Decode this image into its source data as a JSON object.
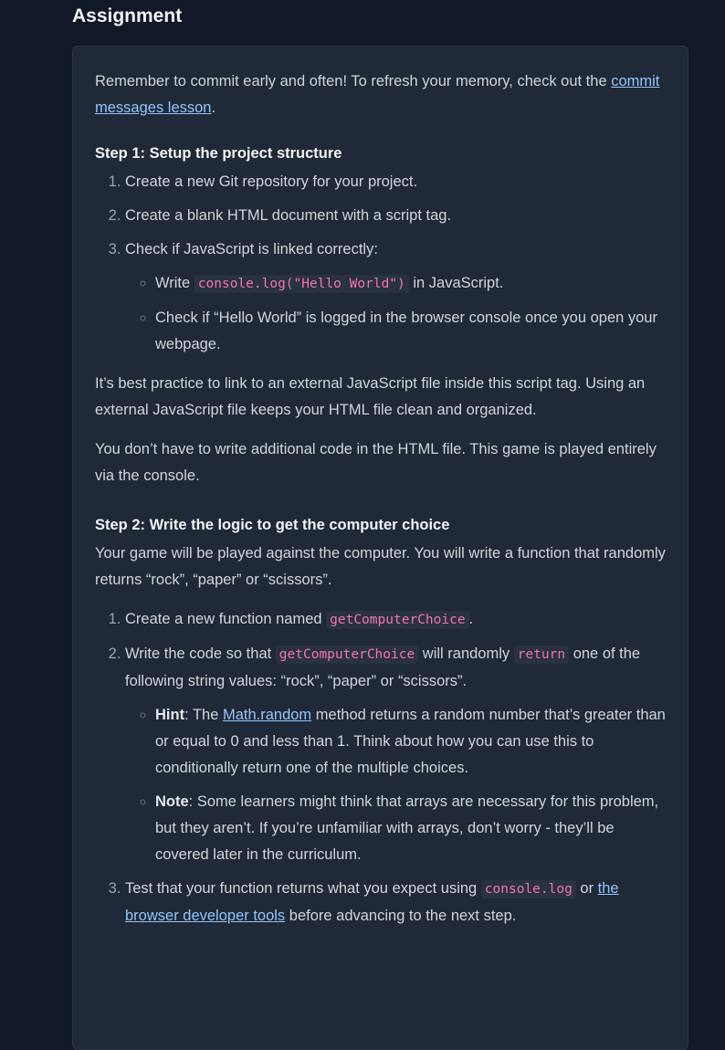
{
  "title": "Assignment",
  "intro": {
    "text": "Remember to commit early and often! To refresh your memory, check out the ",
    "link": "commit messages lesson",
    "end": "."
  },
  "step1": {
    "heading": "Step 1: Setup the project structure",
    "items": [
      "Create a new Git repository for your project.",
      "Create a blank HTML document with a script tag.",
      "Check if JavaScript is linked correctly:"
    ],
    "sub": {
      "a_pre": "Write ",
      "a_code": "console.log(\"Hello World\")",
      "a_post": " in JavaScript.",
      "b": "Check if “Hello World” is logged in the browser console once you open your webpage."
    },
    "p1": "It’s best practice to link to an external JavaScript file inside this script tag. Using an external JavaScript file keeps your HTML file clean and organized.",
    "p2": "You don’t have to write additional code in the HTML file. This game is played entirely via the console."
  },
  "step2": {
    "heading": "Step 2: Write the logic to get the computer choice",
    "intro": "Your game will be played against the computer. You will write a function that randomly returns “rock”, “paper” or “scissors”.",
    "item1": {
      "pre": "Create a new function named ",
      "code": "getComputerChoice",
      "post": "."
    },
    "item2": {
      "pre": "Write the code so that ",
      "code": "getComputerChoice",
      "mid": " will randomly ",
      "code2": "return",
      "post": " one of the following string values: “rock”, “paper” or “scissors”."
    },
    "hint": {
      "label": "Hint",
      "pre": ": The ",
      "link": "Math.random",
      "post": " method returns a random number that’s greater than or equal to 0 and less than 1. Think about how you can use this to conditionally return one of the multiple choices."
    },
    "note": {
      "label": "Note",
      "text": ": Some learners might think that arrays are necessary for this problem, but they aren’t. If you’re unfamiliar with arrays, don’t worry - they’ll be covered later in the curriculum."
    },
    "item3": {
      "pre": "Test that your function returns what you expect using ",
      "code": "console.log",
      "mid": " or ",
      "link": "the browser developer tools",
      "post": " before advancing to the next step."
    }
  }
}
